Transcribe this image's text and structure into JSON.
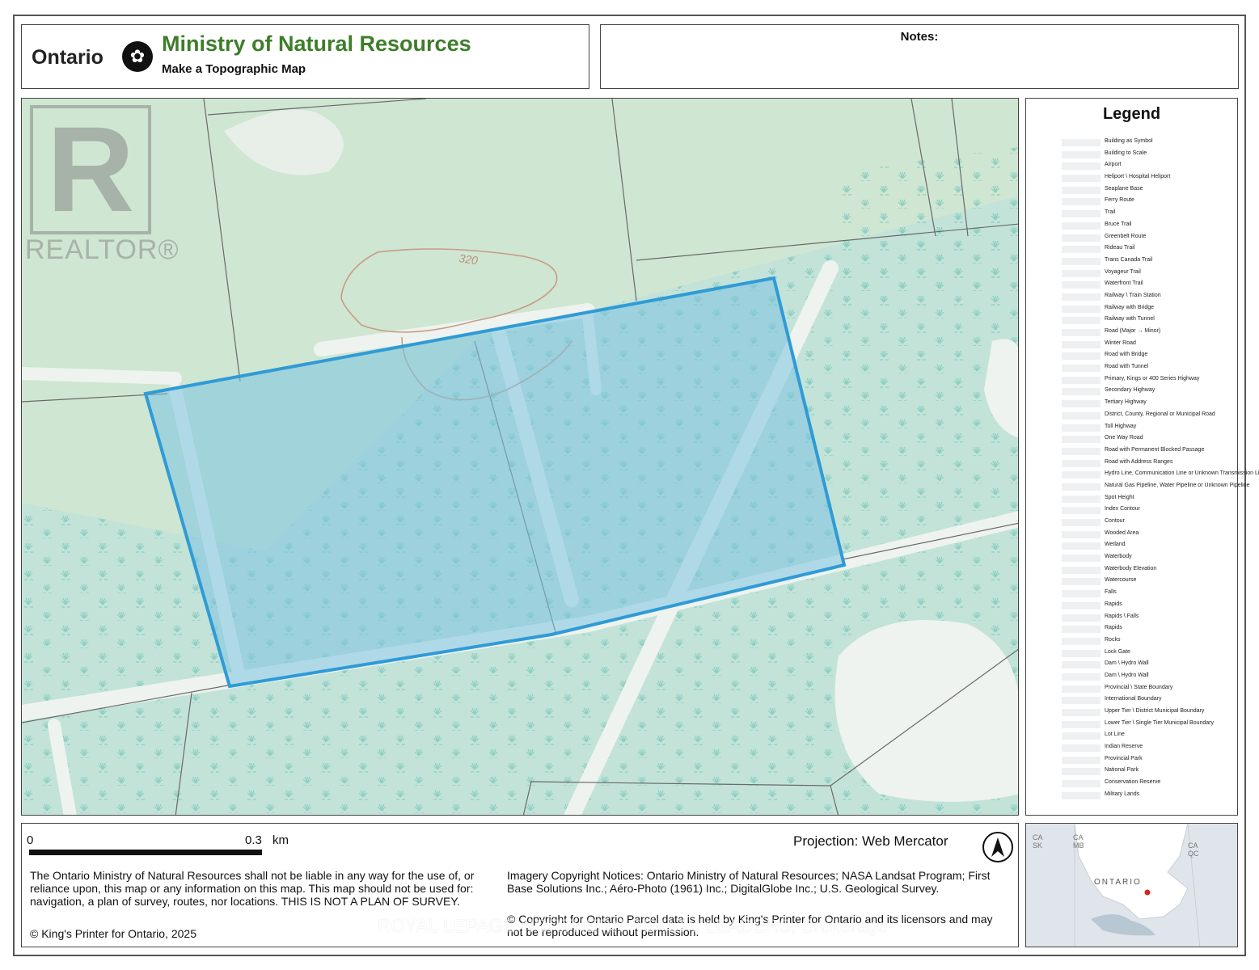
{
  "header": {
    "ontario_wordmark": "Ontario",
    "ministry_title": "Ministry of Natural Resources",
    "subtitle": "Make a Topographic Map",
    "notes_label": "Notes:"
  },
  "realtor_logo": {
    "text": "REALTOR®",
    "icon": "realtor-r-icon"
  },
  "map": {
    "contour_label": "320",
    "colors": {
      "woodland": "#cfe6d2",
      "wetland": "#bfe0da",
      "road": "#eef3ef",
      "parcel_fill": "#7cc3e0",
      "parcel_stroke": "#2f9bd6",
      "contour": "#c79c87",
      "lot_line": "#6a6a6a"
    }
  },
  "legend": {
    "title": "Legend",
    "items": [
      "Building as Symbol",
      "Building to Scale",
      "Airport",
      "Heliport \\ Hospital Heliport",
      "Seaplane Base",
      "Ferry Route",
      "Trail",
      "Bruce Trail",
      "Greenbelt Route",
      "Rideau Trail",
      "Trans Canada Trail",
      "Voyageur Trail",
      "Waterfront Trail",
      "Railway \\ Train Station",
      "Railway with Bridge",
      "Railway with Tunnel",
      "Road (Major → Minor)",
      "Winter Road",
      "Road with Bridge",
      "Road with Tunnel",
      "Primary, Kings or 400 Series Highway",
      "Secondary Highway",
      "Tertiary Highway",
      "District, County, Regional or Municipal Road",
      "Toll Highway",
      "One Way Road",
      "Road with Permanent Blocked Passage",
      "Road with Address Ranges",
      "Hydro Line, Communication Line or Unknown Transmission Line",
      "Natural Gas Pipeline, Water Pipeline or Unknown Pipeline",
      "Spot Height",
      "Index Contour",
      "Contour",
      "Wooded Area",
      "Wetland",
      "Waterbody",
      "Waterbody Elevation",
      "Watercourse",
      "Falls",
      "Rapids",
      "Rapids \\ Falls",
      "Rapids",
      "Rocks",
      "Lock Gate",
      "Dam \\ Hydro Wall",
      "Dam \\ Hydro Wall",
      "Provincial \\ State Boundary",
      "International Boundary",
      "Upper Tier \\ District Municipal Boundary",
      "Lower Tier \\ Single Tier Municipal Boundary",
      "Lot Line",
      "Indian Reserve",
      "Provincial Park",
      "National Park",
      "Conservation Reserve",
      "Military Lands"
    ]
  },
  "footer": {
    "scale_start": "0",
    "scale_end": "0.3",
    "scale_unit": "km",
    "projection": "Projection: Web Mercator",
    "disclaimer": "The Ontario Ministry of Natural Resources shall not be liable in any way for the use of, or reliance upon, this map or any information on this map.  This map should not be used for: navigation, a plan of survey, routes, nor locations. THIS IS NOT A PLAN OF SURVEY.",
    "imagery": "Imagery Copyright Notices: Ontario Ministry of Natural Resources; NASA Landsat Program; First Base Solutions Inc.; Aéro-Photo (1961) Inc.; DigitalGlobe Inc.; U.S. Geological Survey.",
    "parcel": "© Copyright for Ontario Parcel data is held by King's Printer for Ontario and its licensors and may not be reproduced without permission.",
    "copyright": "© King's Printer for Ontario,  2025",
    "north_icon": "north-arrow-icon"
  },
  "inset": {
    "labels": {
      "ca_sk": "CA\nSK",
      "ca_mb": "CA\nMB",
      "ca_qc": "CA\nQC",
      "ontario": "ONTARIO"
    },
    "marker_color": "#d9261c"
  },
  "watermark": "ROYAL LEPAGE NORTHERN REALTY LEADERS, Brokerage"
}
